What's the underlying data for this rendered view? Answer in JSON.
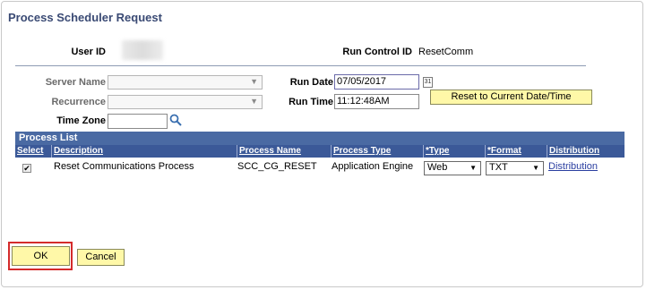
{
  "page": {
    "title": "Process Scheduler Request"
  },
  "header": {
    "user_id_label": "User ID",
    "run_control_label": "Run Control ID",
    "run_control_value": "ResetComm"
  },
  "form": {
    "server_name_label": "Server Name",
    "recurrence_label": "Recurrence",
    "time_zone_label": "Time Zone",
    "run_date_label": "Run Date",
    "run_date_value": "07/05/2017",
    "run_time_label": "Run Time",
    "run_time_value": "11:12:48AM",
    "reset_button_label": "Reset to Current Date/Time"
  },
  "process_list": {
    "title": "Process List",
    "columns": [
      "Select",
      "Description",
      "Process Name",
      "Process Type",
      "*Type",
      "*Format",
      "Distribution"
    ],
    "rows": [
      {
        "selected": true,
        "description": "Reset Communications Process",
        "process_name": "SCC_CG_RESET",
        "process_type": "Application Engine",
        "type": "Web",
        "format": "TXT",
        "distribution": "Distribution"
      }
    ]
  },
  "footer": {
    "ok_label": "OK",
    "cancel_label": "Cancel"
  },
  "icons": {
    "calendar": "calendar-icon",
    "lookup": "magnifier-lookup-icon",
    "checkbox": "checkmark-icon"
  },
  "colors": {
    "grid_header": "#3b5998",
    "grid_title": "#4a6aa3",
    "button": "#fff8a8",
    "highlight": "#d42b2b"
  }
}
